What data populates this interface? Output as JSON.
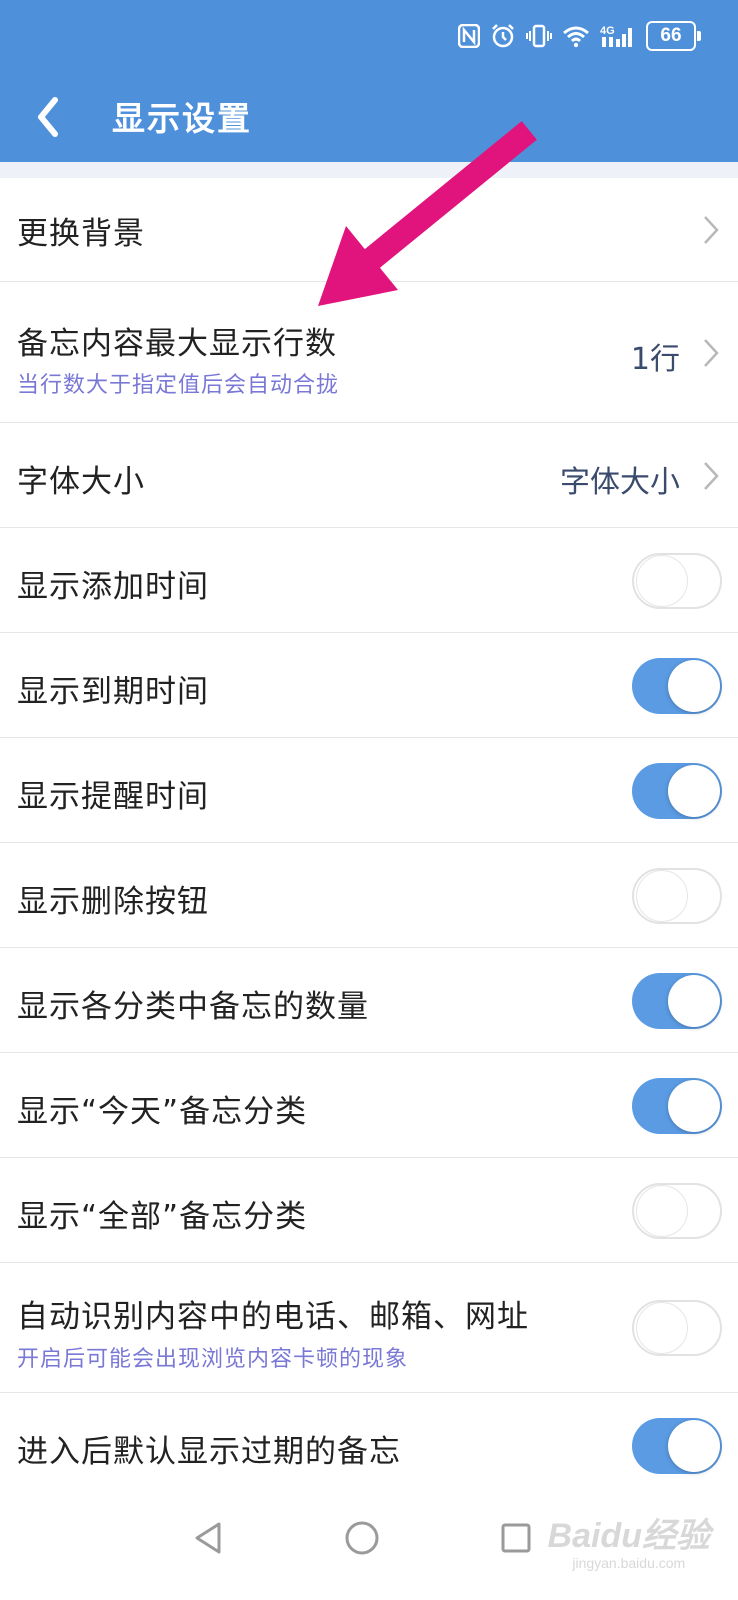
{
  "status_bar": {
    "network": "4G",
    "battery": "66"
  },
  "header": {
    "title": "显示设置"
  },
  "settings": {
    "background": {
      "label": "更换背景"
    },
    "max_lines": {
      "label": "备忘内容最大显示行数",
      "sub": "当行数大于指定值后会自动合拢",
      "value": "1行"
    },
    "font_size": {
      "label": "字体大小",
      "value": "字体大小"
    },
    "show_add_time": {
      "label": "显示添加时间",
      "enabled": false
    },
    "show_due_time": {
      "label": "显示到期时间",
      "enabled": true
    },
    "show_remind_time": {
      "label": "显示提醒时间",
      "enabled": true
    },
    "show_delete_button": {
      "label": "显示删除按钮",
      "enabled": false
    },
    "show_category_count": {
      "label": "显示各分类中备忘的数量",
      "enabled": true
    },
    "show_today_category": {
      "label": "显示“今天”备忘分类",
      "enabled": true
    },
    "show_all_category": {
      "label": "显示“全部”备忘分类",
      "enabled": false
    },
    "auto_detect": {
      "label": "自动识别内容中的电话、邮箱、网址",
      "sub": "开启后可能会出现浏览内容卡顿的现象",
      "enabled": false
    },
    "show_expired": {
      "label": "进入后默认显示过期的备忘",
      "enabled": true
    }
  },
  "colors": {
    "accent": "#4f90db",
    "toggle_on": "#5b9be3",
    "subtext": "#7a78d6",
    "annotation_arrow": "#e0147c"
  },
  "watermark": {
    "main": "Baidu经验",
    "sub": "jingyan.baidu.com"
  }
}
